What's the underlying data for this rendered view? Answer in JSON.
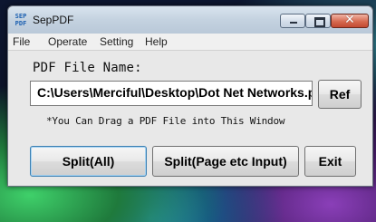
{
  "window": {
    "title": "SepPDF",
    "icon_name": "seppdf-app-icon",
    "icon_text": "SEP PDF",
    "controls": {
      "minimize_icon": "minimize-icon",
      "maximize_icon": "maximize-icon",
      "close_icon": "close-icon",
      "close_glyph": "✕"
    }
  },
  "menu": {
    "items": [
      {
        "label": "File"
      },
      {
        "label": "Operate"
      },
      {
        "label": "Setting"
      },
      {
        "label": "Help"
      }
    ]
  },
  "form": {
    "pdf_label": "PDF File Name:",
    "path_value": "C:\\Users\\Merciful\\Desktop\\Dot Net Networks.pdf",
    "ref_button": "Ref",
    "hint": "*You Can Drag a PDF File into This Window"
  },
  "actions": {
    "split_all": "Split(All)",
    "split_page": "Split(Page etc Input)",
    "exit": "Exit"
  },
  "colors": {
    "window_bg": "#e8e8e8",
    "titlebar": "#c4d2e0",
    "close_button": "#c24a32",
    "focus_border": "#3c7fb1"
  }
}
